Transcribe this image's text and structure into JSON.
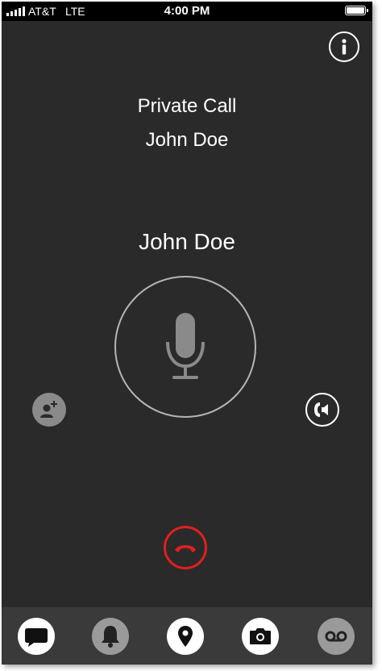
{
  "status_bar": {
    "carrier": "AT&T",
    "network": "LTE",
    "time": "4:00 PM"
  },
  "call": {
    "type": "Private Call",
    "contact": "John Doe",
    "current_speaker": "John Doe"
  },
  "icons": {
    "info": "info-icon",
    "microphone": "microphone-icon",
    "add_user": "add-user-icon",
    "speaker": "speaker-icon",
    "end_call": "end-call-icon"
  },
  "tabs": [
    {
      "name": "messages",
      "icon": "chat-bubble-icon",
      "state": "active"
    },
    {
      "name": "alerts",
      "icon": "bell-icon",
      "state": "inactive"
    },
    {
      "name": "location",
      "icon": "location-pin-icon",
      "state": "active"
    },
    {
      "name": "camera",
      "icon": "camera-icon",
      "state": "active"
    },
    {
      "name": "voicemail",
      "icon": "voicemail-icon",
      "state": "inactive"
    }
  ],
  "colors": {
    "background": "#2a2a2a",
    "status_bar": "#000000",
    "end_call": "#e02020",
    "tab_bar": "#3a3a3a",
    "mic_gray": "#8a8a8a"
  }
}
